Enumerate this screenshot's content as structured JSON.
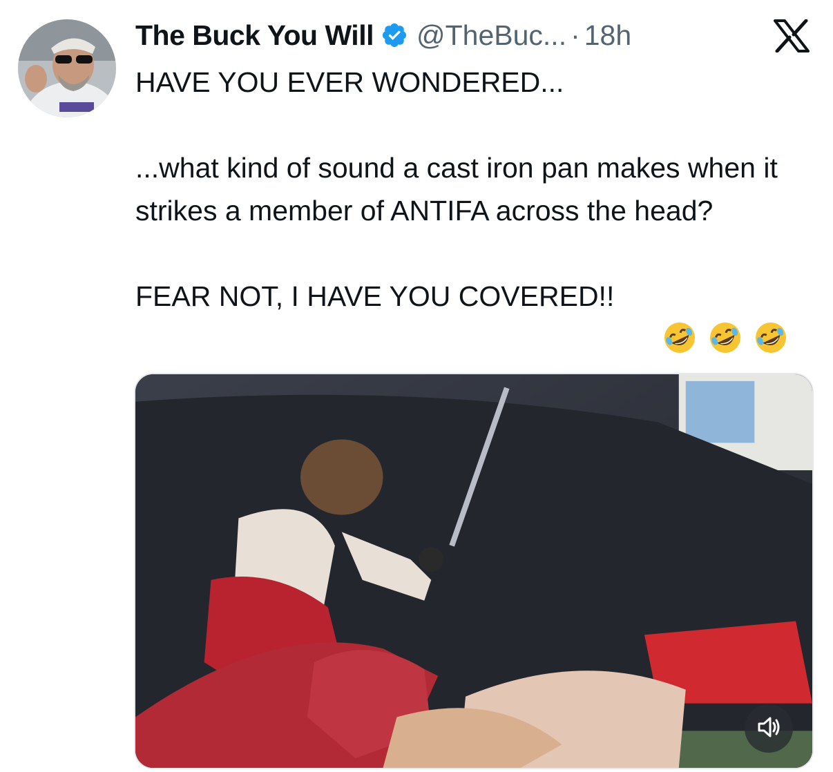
{
  "post": {
    "display_name": "The Buck You Will",
    "handle": "@TheBuc...",
    "separator": "·",
    "time": "18h",
    "text": "HAVE YOU EVER WONDERED...\n\n...what kind of sound a cast iron pan makes when it strikes a member of ANTIFA across the head?\n\nFEAR NOT, I HAVE YOU COVERED!!",
    "emojis": [
      "rolling-on-floor-laughing",
      "rolling-on-floor-laughing",
      "rolling-on-floor-laughing"
    ]
  },
  "icons": {
    "verified": "verified-badge-icon",
    "platform": "x-logo-icon",
    "sound": "speaker-icon"
  },
  "colors": {
    "verified": "#1d9bf0",
    "secondary_text": "#536471",
    "primary_text": "#0f1419"
  }
}
